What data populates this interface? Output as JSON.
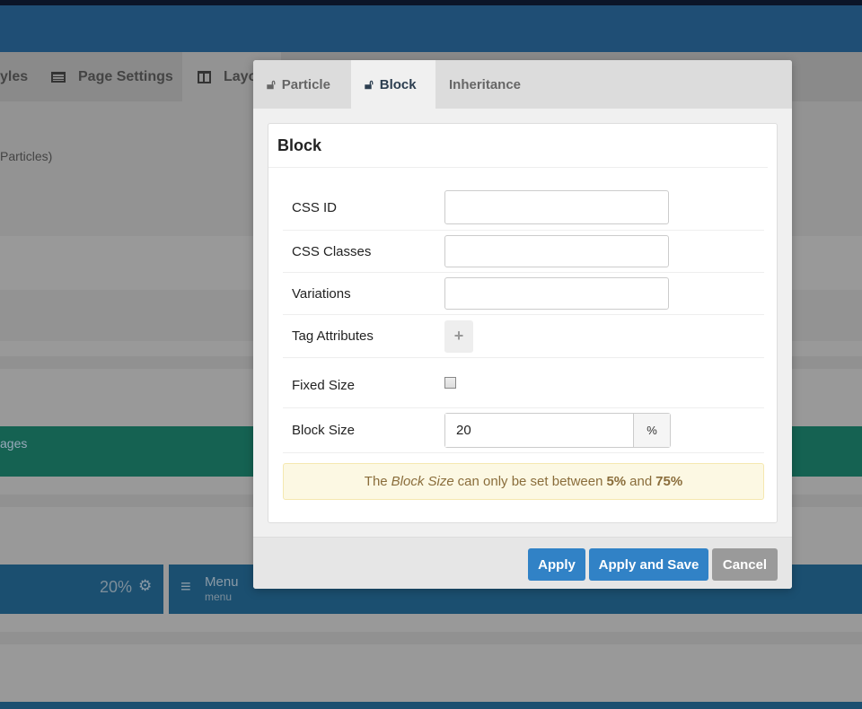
{
  "background": {
    "tabs": [
      {
        "label": "yles"
      },
      {
        "label": "Page Settings",
        "icon": "list-icon"
      },
      {
        "label": "Layo",
        "icon": "columns-icon"
      }
    ],
    "section_text": "Particles)",
    "green_row_text": "ages",
    "block_size": "20%",
    "menu_title": "Menu",
    "menu_sub": "menu"
  },
  "modal": {
    "tabs": [
      {
        "label": "Particle",
        "icon": "unlock-icon"
      },
      {
        "label": "Block",
        "icon": "unlock-icon",
        "active": true
      },
      {
        "label": "Inheritance"
      }
    ],
    "card_title": "Block",
    "fields": {
      "css_id": {
        "label": "CSS ID",
        "value": ""
      },
      "css_classes": {
        "label": "CSS Classes",
        "value": ""
      },
      "variations": {
        "label": "Variations",
        "value": ""
      },
      "tag_attributes": {
        "label": "Tag Attributes",
        "button": "+"
      },
      "fixed_size": {
        "label": "Fixed Size",
        "checked": false
      },
      "block_size": {
        "label": "Block Size",
        "value": "20",
        "unit": "%"
      }
    },
    "alert": {
      "pre": "The",
      "em": "Block Size",
      "mid": "can only be set between",
      "min": "5%",
      "and": "and",
      "max": "75%"
    },
    "buttons": {
      "apply": "Apply",
      "apply_save": "Apply and Save",
      "cancel": "Cancel"
    },
    "colors": {
      "primary": "#3182c6",
      "cancel": "#9a9a9a",
      "header": "#1f4e75",
      "green": "#156252"
    }
  }
}
